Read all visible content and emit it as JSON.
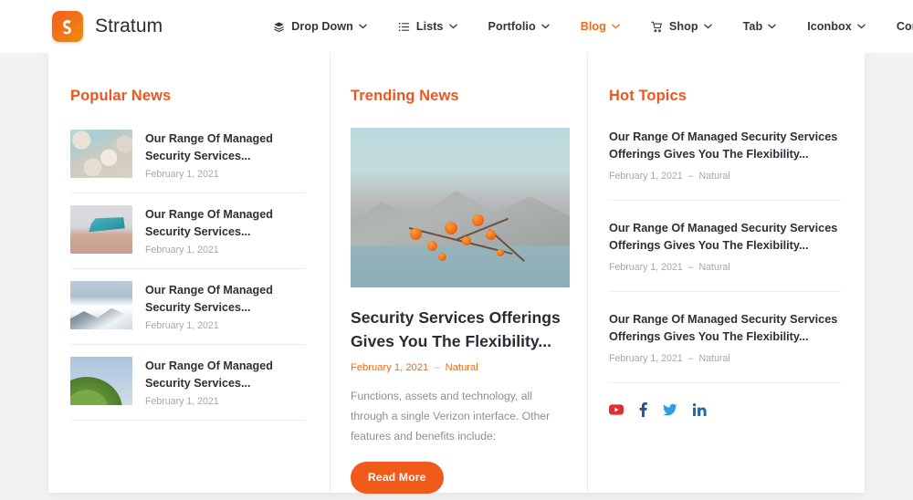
{
  "brand": {
    "name": "Stratum",
    "logo_icon": "stratum-s-logo",
    "accent": "#f0551c"
  },
  "nav": {
    "items": [
      {
        "label": "Drop Down",
        "icon": "layers-icon",
        "caret": true,
        "active": false
      },
      {
        "label": "Lists",
        "icon": "list-icon",
        "caret": true,
        "active": false
      },
      {
        "label": "Portfolio",
        "icon": "",
        "caret": true,
        "active": false
      },
      {
        "label": "Blog",
        "icon": "",
        "caret": true,
        "active": true
      },
      {
        "label": "Shop",
        "icon": "cart-icon",
        "caret": true,
        "active": false
      },
      {
        "label": "Tab",
        "icon": "",
        "caret": true,
        "active": false
      },
      {
        "label": "Iconbox",
        "icon": "",
        "caret": true,
        "active": false
      },
      {
        "label": "Contact",
        "icon": "",
        "caret": true,
        "active": false
      }
    ]
  },
  "popular": {
    "title": "Popular News",
    "items": [
      {
        "title": "Our Range Of Managed Security Services...",
        "date": "February 1, 2021",
        "thumb": "thumb-rocks"
      },
      {
        "title": "Our Range Of Managed Security Services...",
        "date": "February 1, 2021",
        "thumb": "thumb-lifeguard"
      },
      {
        "title": "Our Range Of Managed Security Services...",
        "date": "February 1, 2021",
        "thumb": "thumb-mountain"
      },
      {
        "title": "Our Range Of Managed Security Services...",
        "date": "February 1, 2021",
        "thumb": "thumb-palm"
      }
    ]
  },
  "trending": {
    "title": "Trending News",
    "featured": {
      "image_alt": "orange-berries-branch-over-lake",
      "title": "Security Services Offerings Gives You The Flexibility...",
      "date": "February 1, 2021",
      "separator": "–",
      "category": "Natural",
      "excerpt": "Functions, assets and technology, all through a single Verizon interface. Other features and benefits include:",
      "button_label": "Read More"
    }
  },
  "hot": {
    "title": "Hot Topics",
    "items": [
      {
        "title": "Our Range Of Managed Security Services Offerings Gives You The Flexibility...",
        "date": "February 1, 2021",
        "separator": "–",
        "category": "Natural"
      },
      {
        "title": "Our Range Of Managed Security Services Offerings Gives You The Flexibility...",
        "date": "February 1, 2021",
        "separator": "–",
        "category": "Natural"
      },
      {
        "title": "Our Range Of Managed Security Services Offerings Gives You The Flexibility...",
        "date": "February 1, 2021",
        "separator": "–",
        "category": "Natural"
      }
    ],
    "socials": [
      {
        "name": "youtube-icon",
        "color": "#e02f2f"
      },
      {
        "name": "facebook-icon",
        "color": "#2c4f9e"
      },
      {
        "name": "twitter-icon",
        "color": "#2e9fe0"
      },
      {
        "name": "linkedin-icon",
        "color": "#2667a8"
      }
    ]
  }
}
